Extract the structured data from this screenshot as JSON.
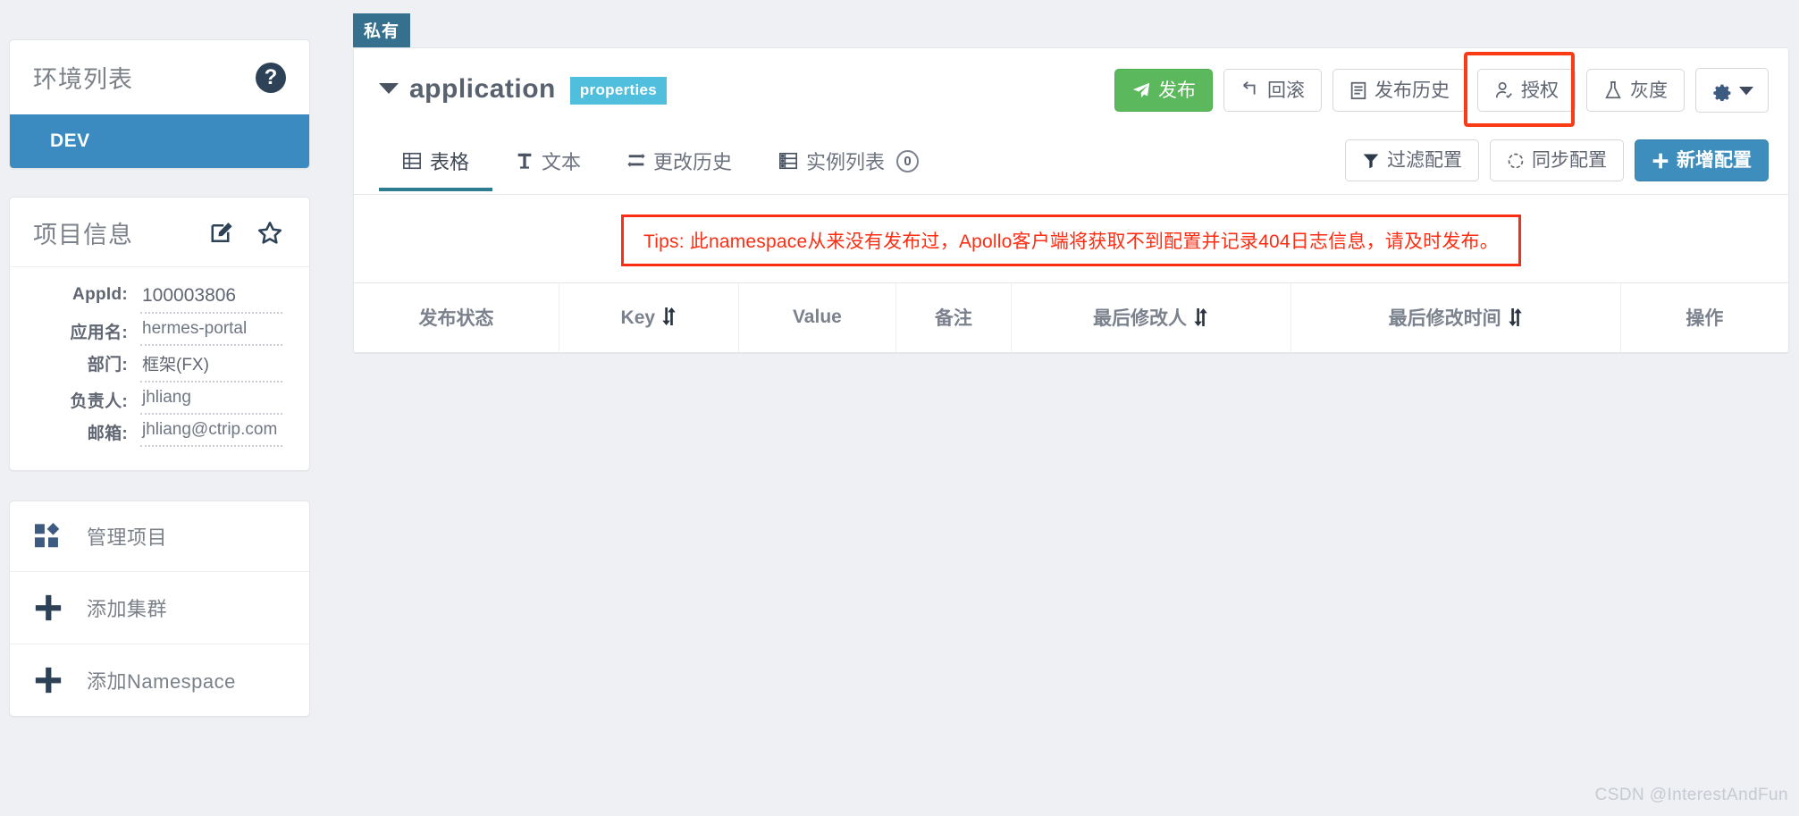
{
  "sidebar": {
    "env_panel": {
      "title": "环境列表",
      "help_icon": "question-mark-icon",
      "items": [
        {
          "label": "DEV",
          "active": true
        }
      ]
    },
    "project_panel": {
      "title": "项目信息",
      "edit_icon": "edit-pencil-icon",
      "favorite_icon": "star-icon",
      "fields": [
        {
          "label": "AppId:",
          "value": "100003806"
        },
        {
          "label": "应用名:",
          "value": "hermes-portal"
        },
        {
          "label": "部门:",
          "value": "框架(FX)"
        },
        {
          "label": "负责人:",
          "value": "jhliang"
        },
        {
          "label": "邮箱:",
          "value": "jhliang@ctrip.com"
        }
      ]
    },
    "actions": [
      {
        "label": "管理项目",
        "icon": "grid-blocks-icon"
      },
      {
        "label": "添加集群",
        "icon": "plus-icon"
      },
      {
        "label": "添加Namespace",
        "icon": "plus-icon"
      }
    ]
  },
  "main": {
    "private_badge": "私有",
    "namespace": {
      "name": "application",
      "format": "properties",
      "caret_icon": "caret-down-icon"
    },
    "toolbar": [
      {
        "label": "发布",
        "icon": "paper-plane-icon",
        "style": "green"
      },
      {
        "label": "回滚",
        "icon": "rollback-arrow-icon",
        "style": "default"
      },
      {
        "label": "发布历史",
        "icon": "clipboard-icon",
        "style": "default"
      },
      {
        "label": "授权",
        "icon": "user-check-icon",
        "style": "default",
        "highlighted": true
      },
      {
        "label": "灰度",
        "icon": "flask-icon",
        "style": "default"
      },
      {
        "label": "",
        "icon": "gear-caret-icon",
        "style": "gear"
      }
    ],
    "tabs": [
      {
        "label": "表格",
        "icon": "table-icon",
        "active": true
      },
      {
        "label": "文本",
        "icon": "text-t-icon",
        "active": false
      },
      {
        "label": "更改历史",
        "icon": "history-swap-icon",
        "active": false
      },
      {
        "label": "实例列表",
        "icon": "server-list-icon",
        "active": false,
        "count": "0"
      }
    ],
    "tab_actions": [
      {
        "label": "过滤配置",
        "icon": "filter-funnel-icon",
        "style": "default"
      },
      {
        "label": "同步配置",
        "icon": "circle-sync-icon",
        "style": "default"
      },
      {
        "label": "新增配置",
        "icon": "plus-icon",
        "style": "blue"
      }
    ],
    "tips": "Tips: 此namespace从来没有发布过，Apollo客户端将获取不到配置并记录404日志信息，请及时发布。",
    "table": {
      "columns": [
        {
          "label": "发布状态",
          "sortable": false,
          "width": "14.3%"
        },
        {
          "label": "Key",
          "sortable": true,
          "width": "12.5%"
        },
        {
          "label": "Value",
          "sortable": false,
          "width": "11%"
        },
        {
          "label": "备注",
          "sortable": false,
          "width": "8%"
        },
        {
          "label": "最后修改人",
          "sortable": true,
          "width": "19.5%"
        },
        {
          "label": "最后修改时间",
          "sortable": true,
          "width": "23%"
        },
        {
          "label": "操作",
          "sortable": false,
          "width": "11.7%"
        }
      ],
      "rows": []
    }
  },
  "watermark": "CSDN @InterestAndFun",
  "colors": {
    "page_bg": "#eef0f4",
    "env_active": "#3b8bc0",
    "private_badge": "#35718f",
    "format_badge": "#4fbfdd",
    "publish_green": "#5cb85c",
    "add_blue": "#3d8dbd",
    "tips_red": "#fb2d12",
    "highlight_red": "#fb3b16",
    "active_tab_underline": "#2c7b8e"
  }
}
